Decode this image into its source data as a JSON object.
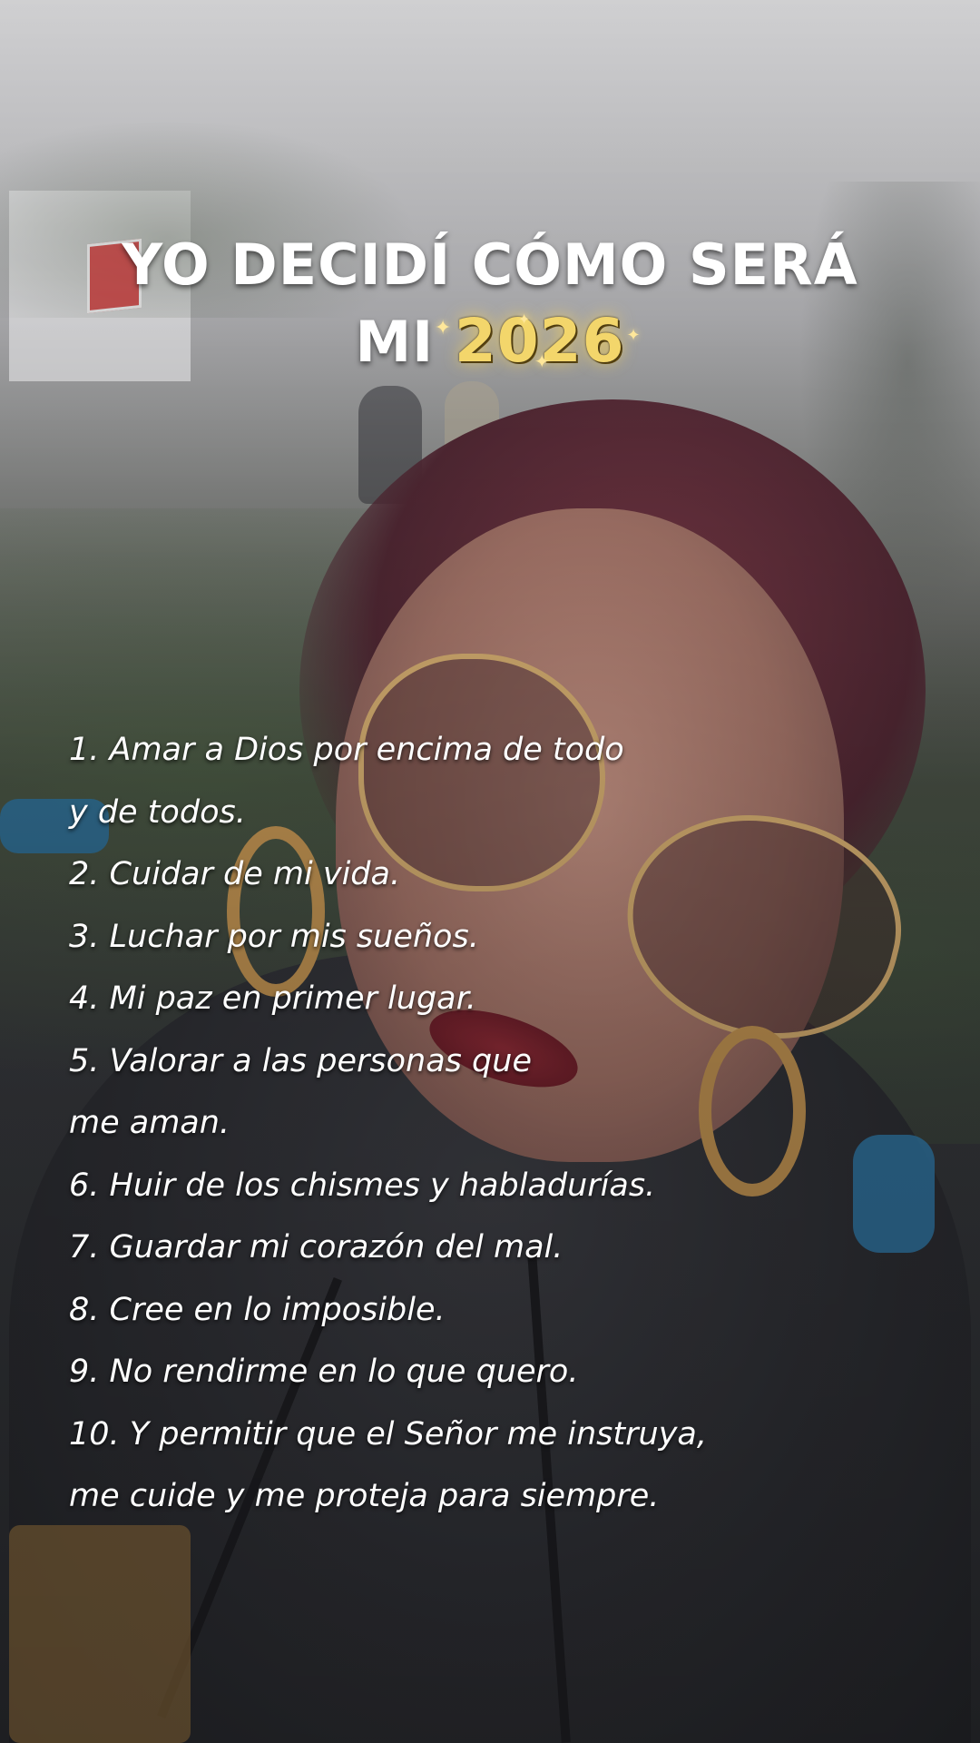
{
  "overlay": {
    "title_line1": "YO DECIDÍ CÓMO SERÁ",
    "title_line2_prefix": "MI",
    "title_year": "2026",
    "list_lines": [
      "1. Amar a Dios por encima de todo",
      "y de todos.",
      "2. Cuidar de mi vida.",
      "3. Luchar por mis sueños.",
      "4. Mi paz en primer lugar.",
      "5. Valorar a las personas que",
      "me aman.",
      "6. Huir de los chismes y habladurías.",
      "7. Guardar mi corazón del mal.",
      "8. Cree en lo imposible.",
      "9. No rendirme en lo que quero.",
      "10. Y permitir que el Señor me instruya,",
      "me cuide y me proteja para siempre."
    ]
  },
  "colors": {
    "title_text": "#ffffff",
    "year_gold": "#f3d66b",
    "list_text": "#ffffff"
  },
  "icons": {
    "sparkle": "sparkle-icon"
  }
}
